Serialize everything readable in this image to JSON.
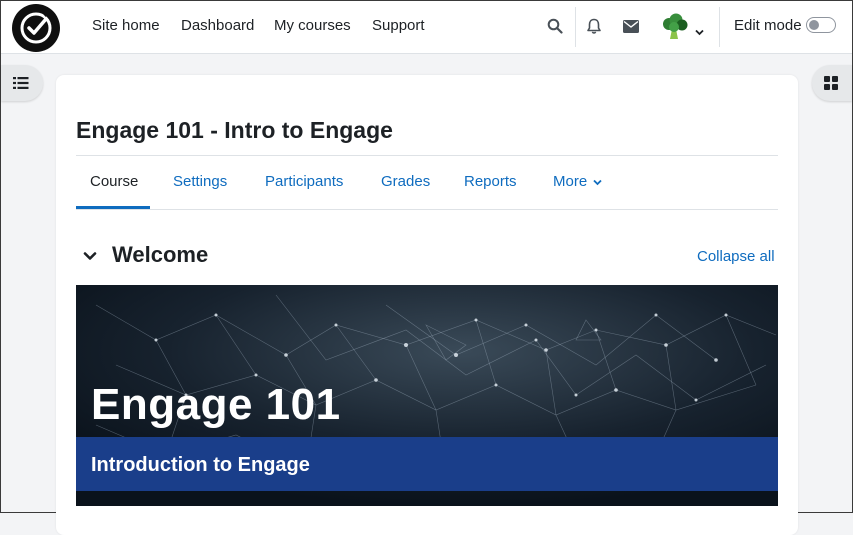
{
  "nav": {
    "links": [
      "Site home",
      "Dashboard",
      "My courses",
      "Support"
    ],
    "edit_mode_label": "Edit mode",
    "edit_mode_on": false
  },
  "icons": {
    "logo": "check-circle-logo-icon",
    "search": "search-icon",
    "notifications": "bell-icon",
    "messages": "envelope-icon",
    "avatar": "broccoli-avatar-icon",
    "user_menu": "chevron-down-icon",
    "course_index": "list-icon",
    "block_drawer": "grid-icon",
    "section_toggle": "chevron-down-icon"
  },
  "course": {
    "title": "Engage 101 - Intro to Engage",
    "tabs": [
      "Course",
      "Settings",
      "Participants",
      "Grades",
      "Reports",
      "More"
    ],
    "active_tab": "Course"
  },
  "section": {
    "title": "Welcome",
    "collapse_all": "Collapse all"
  },
  "banner": {
    "title": "Engage 101",
    "subtitle": "Introduction to Engage"
  },
  "colors": {
    "accent": "#0f6cbf",
    "banner_strip": "#1a3e8a",
    "navbar_bg": "#ffffff",
    "page_bg": "#f3f4f6"
  }
}
